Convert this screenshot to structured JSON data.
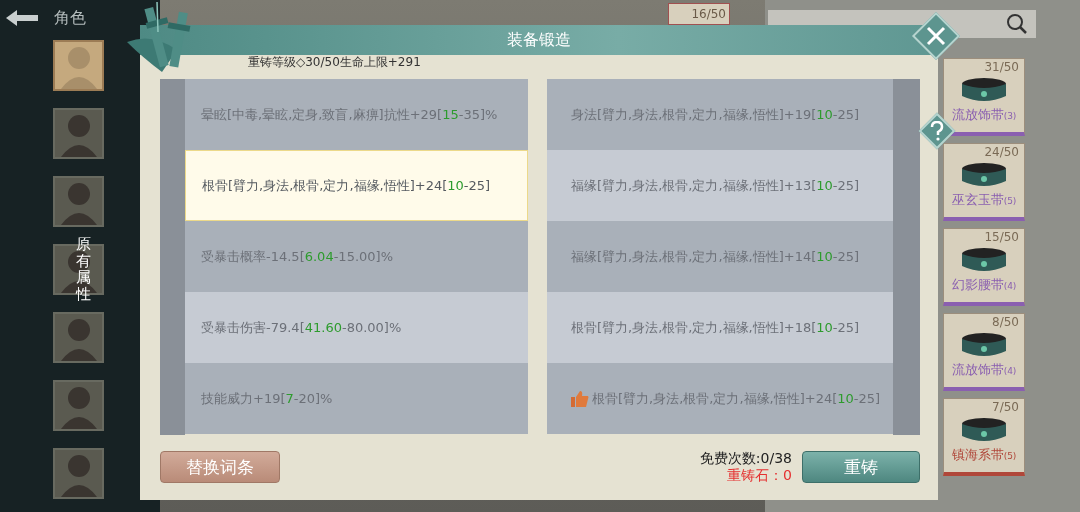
{
  "header": {
    "title": "角色"
  },
  "avatars": [
    {
      "selected": true
    },
    {
      "selected": false
    },
    {
      "selected": false
    },
    {
      "selected": false
    },
    {
      "selected": false
    },
    {
      "selected": false
    },
    {
      "selected": false
    }
  ],
  "overlay_label": "原有属性",
  "top_card": {
    "count": "16/50"
  },
  "items": [
    {
      "count": "31/50",
      "name": "流放饰带",
      "level": "(3)",
      "color": "#8a5fb0"
    },
    {
      "count": "24/50",
      "name": "巫玄玉带",
      "level": "(5)",
      "color": "#8a5fb0"
    },
    {
      "count": "15/50",
      "name": "幻影腰带",
      "level": "(4)",
      "color": "#8a5fb0"
    },
    {
      "count": "8/50",
      "name": "流放饰带",
      "level": "(4)",
      "color": "#8a5fb0"
    },
    {
      "count": "7/50",
      "name": "镇海系带",
      "level": "(5)",
      "color": "#b0473a"
    }
  ],
  "dialog": {
    "title": "装备锻造",
    "subtitle": "重铸等级◇30/50生命上限+291",
    "original_attributes": [
      {
        "before": "晕眩[中毒,晕眩,定身,致盲,麻痹]抗性+29[",
        "low": "15",
        "after": "-35]%",
        "selected": false
      },
      {
        "before": "根骨[臂力,身法,根骨,定力,福缘,悟性]+24[",
        "low": "10",
        "after": "-25]",
        "selected": true
      },
      {
        "before": "受暴击概率-14.5[",
        "low": "6.04",
        "after": "-15.00]%",
        "selected": false
      },
      {
        "before": "受暴击伤害-79.4[",
        "low": "41.60",
        "after": "-80.00]%",
        "selected": false
      },
      {
        "before": "技能威力+19[",
        "low": "7",
        "after": "-20]%",
        "selected": false
      }
    ],
    "new_attributes": [
      {
        "before": "身法[臂力,身法,根骨,定力,福缘,悟性]+19[",
        "low": "10",
        "after": "-25]",
        "recommended": false
      },
      {
        "before": "福缘[臂力,身法,根骨,定力,福缘,悟性]+13[",
        "low": "10",
        "after": "-25]",
        "recommended": false
      },
      {
        "before": "福缘[臂力,身法,根骨,定力,福缘,悟性]+14[",
        "low": "10",
        "after": "-25]",
        "recommended": false
      },
      {
        "before": "根骨[臂力,身法,根骨,定力,福缘,悟性]+18[",
        "low": "10",
        "after": "-25]",
        "recommended": false
      },
      {
        "before": "根骨[臂力,身法,根骨,定力,福缘,悟性]+24[",
        "low": "10",
        "after": "-25]",
        "recommended": true
      }
    ],
    "replace_button": "替换词条",
    "free_count": "免费次数:0/38",
    "stone_count": "重铸石：0",
    "reforge_button": "重铸"
  }
}
